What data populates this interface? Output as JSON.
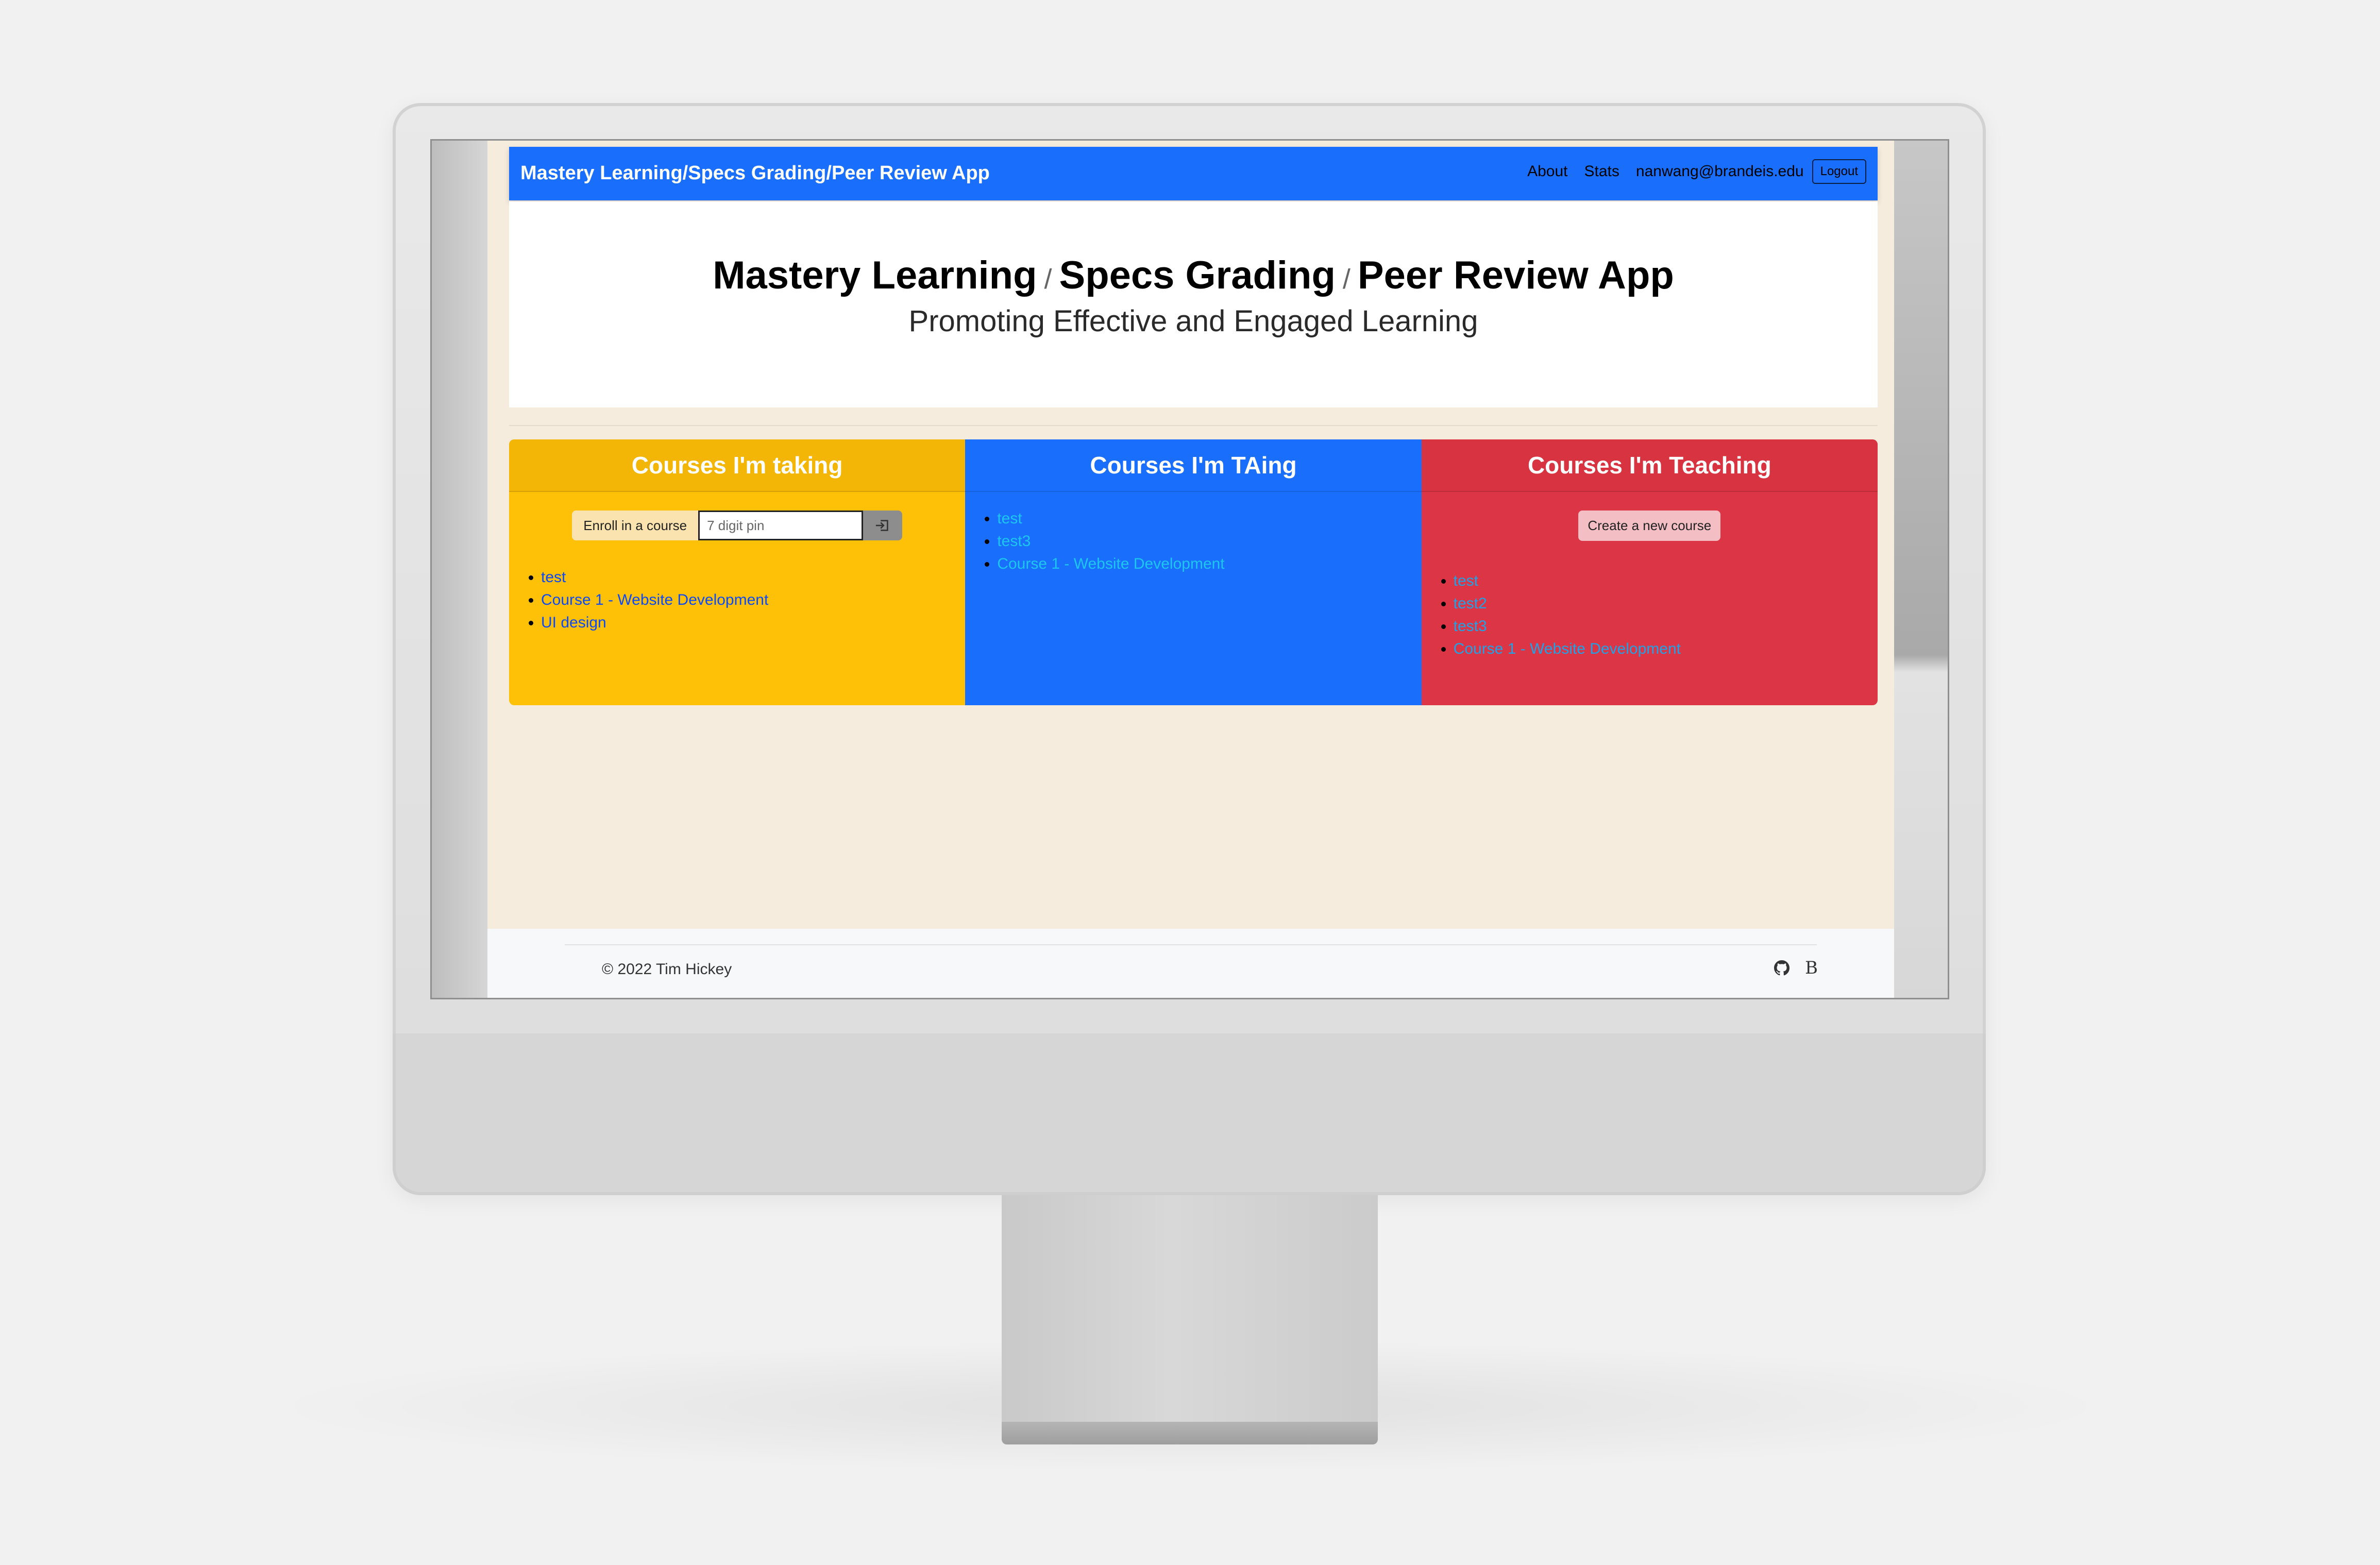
{
  "app": {
    "brand": "Mastery Learning/Specs Grading/Peer Review App",
    "nav": {
      "about": "About",
      "stats": "Stats",
      "user_email": "nanwang@brandeis.edu",
      "logout": "Logout"
    }
  },
  "hero": {
    "title_part1": "Mastery Learning",
    "title_part2": "Specs Grading",
    "title_part3": "Peer Review App",
    "separator": "/",
    "subtitle": "Promoting Effective and Engaged Learning"
  },
  "panels": {
    "taking": {
      "title": "Courses I'm taking",
      "enroll_label": "Enroll in a course",
      "pin_placeholder": "7 digit pin",
      "enroll_button_icon": "sign-in-icon",
      "courses": [
        "test",
        "Course 1 - Website Development",
        "UI design"
      ]
    },
    "taing": {
      "title": "Courses I'm TAing",
      "courses": [
        "test",
        "test3",
        "Course 1 - Website Development"
      ]
    },
    "teaching": {
      "title": "Courses I'm Teaching",
      "create_button": "Create a new course",
      "courses": [
        "test",
        "test2",
        "test3",
        "Course 1 - Website Development"
      ]
    }
  },
  "footer": {
    "copyright": "© 2022 Tim Hickey",
    "icons": [
      "github-icon",
      "bootstrap-icon"
    ],
    "bootstrap_glyph": "B"
  },
  "colors": {
    "navbar": "#1a6efc",
    "page_bg": "#f6ecdd",
    "taking": "#fec107",
    "taing": "#1a6efc",
    "teaching": "#dc3545"
  }
}
